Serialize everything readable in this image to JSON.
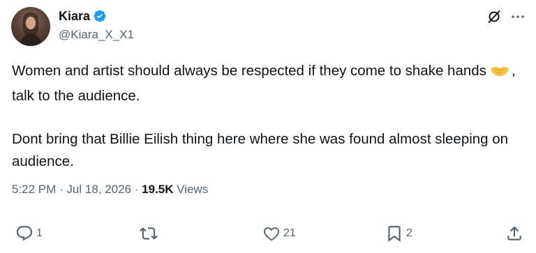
{
  "author": {
    "display_name": "Kiara",
    "handle": "@Kiara_X_X1"
  },
  "tweet": {
    "line1_before_emoji": "Women and artist should always be respected if they come to shake hands",
    "line1_after_emoji": ", talk to the audience.",
    "paragraph2": "Dont bring that Billie Eilish thing here where she was found almost sleeping on audience."
  },
  "meta": {
    "time": "5:22 PM",
    "separator": " · ",
    "date": "Jul 18, 2026",
    "views_count": "19.5K",
    "views_label": " Views"
  },
  "actions": {
    "reply_count": "1",
    "repost_count": "",
    "like_count": "21",
    "bookmark_count": "2"
  },
  "colors": {
    "verified": "#1d9bf0",
    "text": "#0f1419",
    "muted": "#536471"
  },
  "icons": [
    "verified-badge-icon",
    "grok-icon",
    "more-icon",
    "handshake-emoji",
    "reply-icon",
    "repost-icon",
    "like-icon",
    "bookmark-icon",
    "share-icon"
  ]
}
